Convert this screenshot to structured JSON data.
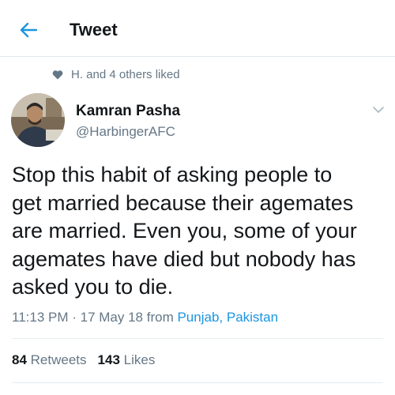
{
  "header": {
    "title": "Tweet"
  },
  "social_context": {
    "text": "H. and 4 others liked"
  },
  "author": {
    "name": "Kamran Pasha",
    "handle": "@HarbingerAFC"
  },
  "tweet": {
    "lines": [
      "Stop this habit of asking people to",
      "get married because their agemates",
      "are married. Even you, some of your",
      "agemates have died but nobody has",
      "asked you to die."
    ]
  },
  "meta": {
    "time": "11:13 PM",
    "separator": " · ",
    "date": "17 May 18",
    "from_label": " from ",
    "location": "Punjab, Pakistan"
  },
  "stats": {
    "retweets_count": "84",
    "retweets_label": "Retweets",
    "likes_count": "143",
    "likes_label": "Likes"
  },
  "colors": {
    "accent": "#1b95e0",
    "muted": "#657786",
    "text": "#14171a"
  },
  "icons": {
    "back": "arrow-left-icon",
    "liked": "heart-icon",
    "menu": "chevron-down-icon"
  }
}
